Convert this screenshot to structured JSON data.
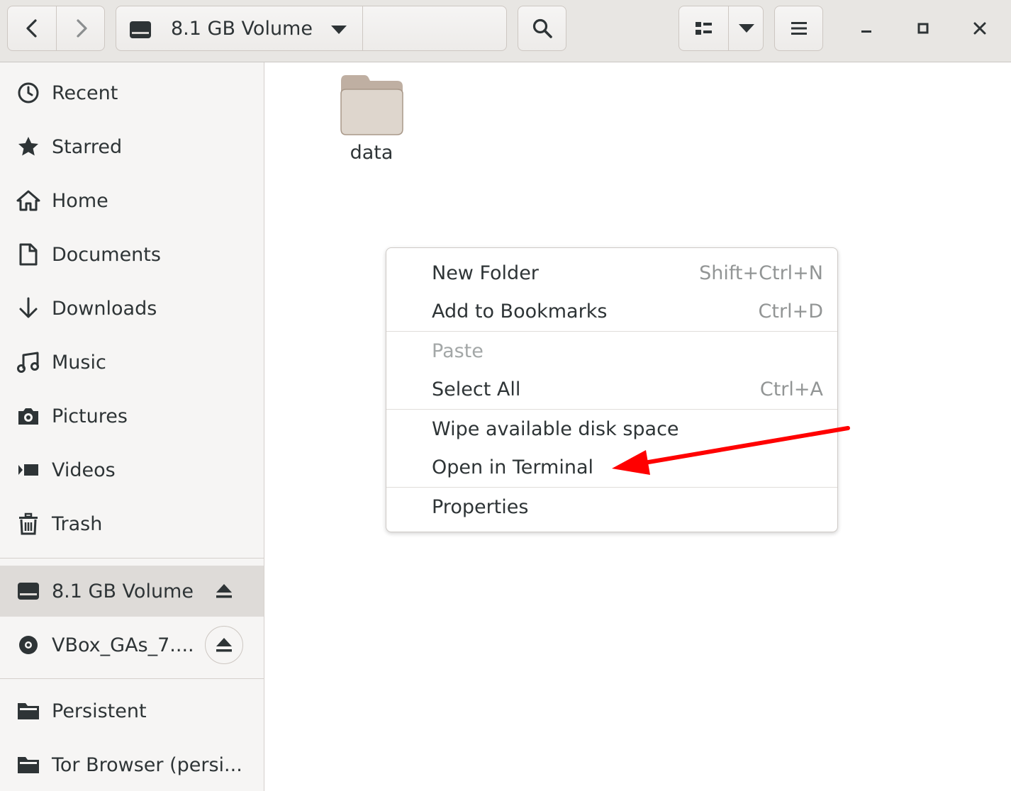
{
  "header": {
    "location_label": "8.1 GB Volume",
    "icons": {
      "back": "chevron-left-icon",
      "forward": "chevron-right-icon",
      "drive": "drive-icon",
      "dropdown": "caret-down-icon",
      "search": "search-icon",
      "view_list": "list-view-icon",
      "view_options": "caret-down-icon",
      "menu": "hamburger-icon",
      "minimize": "minimize-icon",
      "maximize": "maximize-icon",
      "close": "close-icon"
    }
  },
  "sidebar": {
    "places": [
      {
        "label": "Recent",
        "icon": "clock-icon"
      },
      {
        "label": "Starred",
        "icon": "star-icon"
      },
      {
        "label": "Home",
        "icon": "home-icon"
      },
      {
        "label": "Documents",
        "icon": "document-icon"
      },
      {
        "label": "Downloads",
        "icon": "download-icon"
      },
      {
        "label": "Music",
        "icon": "music-icon"
      },
      {
        "label": "Pictures",
        "icon": "camera-icon"
      },
      {
        "label": "Videos",
        "icon": "video-icon"
      },
      {
        "label": "Trash",
        "icon": "trash-icon"
      }
    ],
    "devices": [
      {
        "label": "8.1 GB Volume",
        "icon": "drive-icon",
        "selected": true
      },
      {
        "label": "VBox_GAs_7....",
        "icon": "disc-icon",
        "selected": false
      }
    ],
    "bookmarks": [
      {
        "label": "Persistent",
        "icon": "folder-icon"
      },
      {
        "label": "Tor Browser (persi...",
        "icon": "folder-icon"
      }
    ]
  },
  "content": {
    "items": [
      {
        "name": "data",
        "icon": "folder-icon"
      }
    ]
  },
  "context_menu": {
    "items": [
      {
        "label": "New Folder",
        "accel": "Shift+Ctrl+N",
        "enabled": true
      },
      {
        "label": "Add to Bookmarks",
        "accel": "Ctrl+D",
        "enabled": true
      },
      {
        "label": "Paste",
        "accel": "",
        "enabled": false
      },
      {
        "label": "Select All",
        "accel": "Ctrl+A",
        "enabled": true
      },
      {
        "label": "Wipe available disk space",
        "accel": "",
        "enabled": true
      },
      {
        "label": "Open in Terminal",
        "accel": "",
        "enabled": true
      },
      {
        "label": "Properties",
        "accel": "",
        "enabled": true
      }
    ]
  },
  "annotation": {
    "arrow_color": "#ff0000"
  }
}
